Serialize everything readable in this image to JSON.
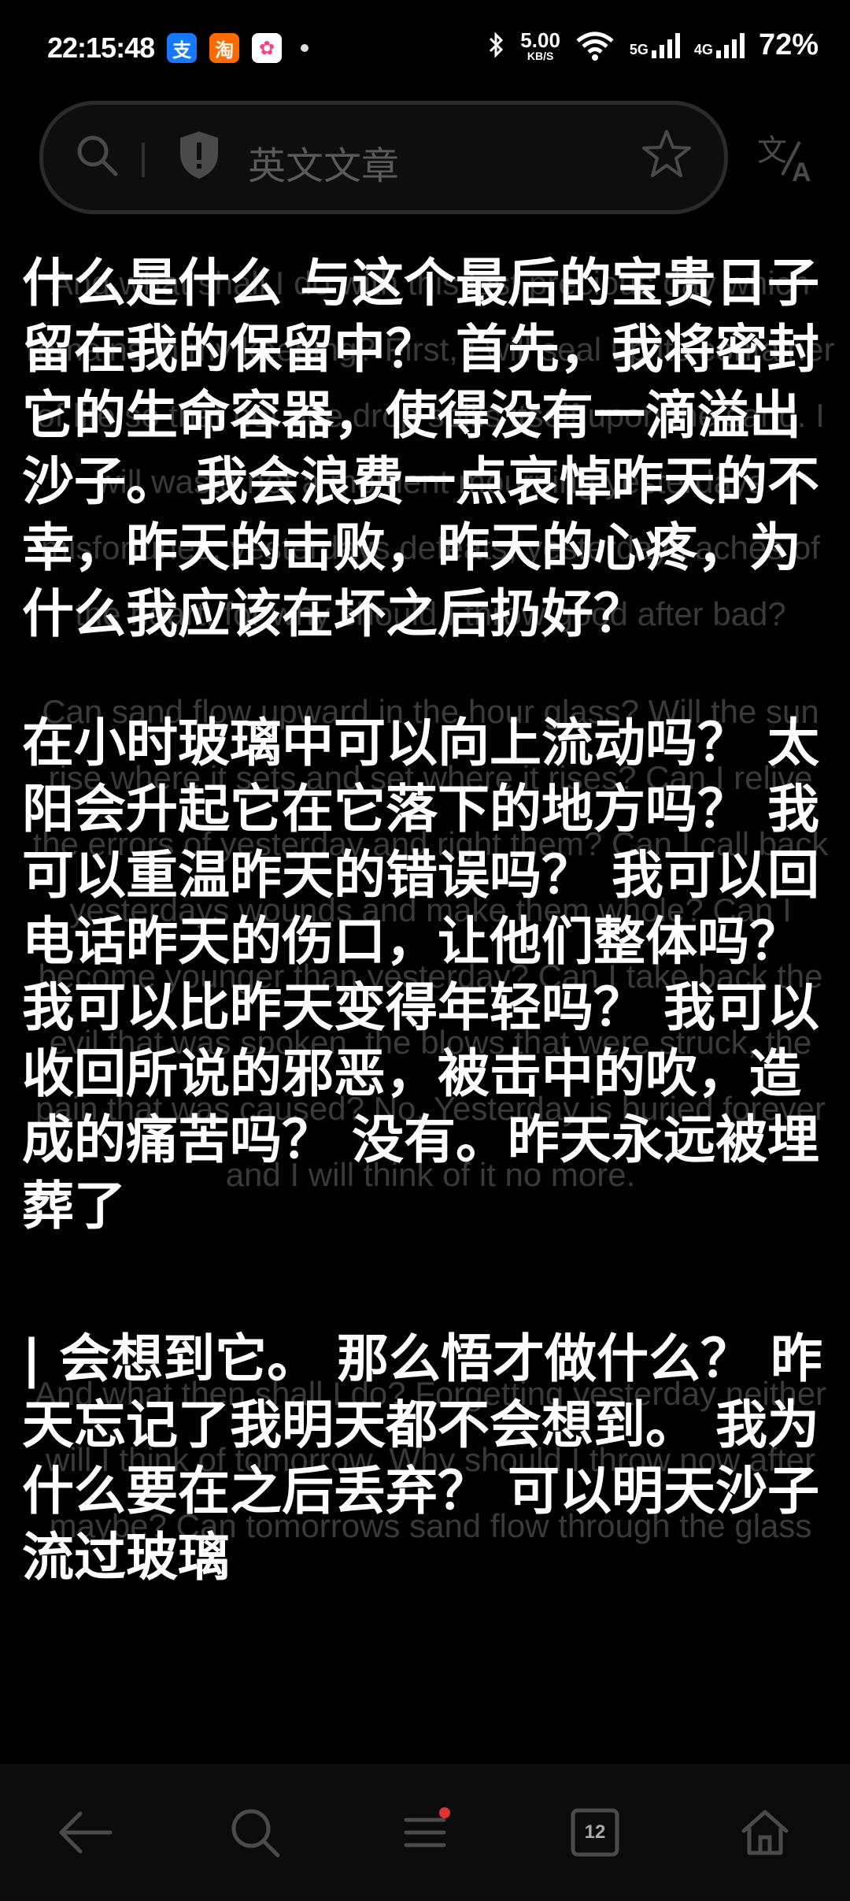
{
  "status": {
    "time": "22:15:48",
    "apps": [
      "支",
      "淘",
      "✿"
    ],
    "speed_value": "5.00",
    "speed_unit": "KB/S",
    "net_5g": "5G",
    "net_4g": "4G",
    "battery": "72%"
  },
  "search": {
    "query": "英文文章"
  },
  "content": {
    "para1": {
      "en": "And what shall I do with this last precious day which remains in my keeping? First, I will seal up its container of life so that not one drop spills itself upon the sand. I will waste not a moment mourning yesterdays misfortunes, yesterdays defeats, yesterdays aches of the heart, for why should I throw good after bad?",
      "zh": "什么是什么 与这个最后的宝贵日子留在我的保留中？ 首先，我将密封它的生命容器，使得没有一滴溢出沙子。 我会浪费一点哀悼昨天的不幸，昨天的击败，昨天的心疼，为什么我应该在坏之后扔好？"
    },
    "para2": {
      "en": "Can sand flow upward in the hour glass? Will the sun rise where it sets and set where it rises? Can I relive the errors of yesterday and right them? Can I call back yesterdays wounds and make them whole? Can I become younger than yesterday? Can I take back the evil that was spoken, the blows that were struck, the pain that was caused? No. Yesterday is buried forever and I will think of it no more.",
      "zh": "在小时玻璃中可以向上流动吗？ 太阳会升起它在它落下的地方吗？ 我可以重温昨天的错误吗？ 我可以回电话昨天的伤口，让他们整体吗？ 我可以比昨天变得年轻吗？ 我可以收回所说的邪恶，被击中的吹，造成的痛苦吗？ 没有。昨天永远被埋葬了"
    },
    "para3": {
      "en": "And what then shall I do? Forgetting yesterday neither will I think of tomorrow. Why should I throw now after maybe? Can tomorrows sand flow through the glass",
      "zh": "| 会想到它。 那么悟才做什么？ 昨天忘记了我明天都不会想到。 我为什么要在之后丢弃？ 可以明天沙子流过玻璃"
    }
  },
  "nav": {
    "tabs_count": "12"
  }
}
